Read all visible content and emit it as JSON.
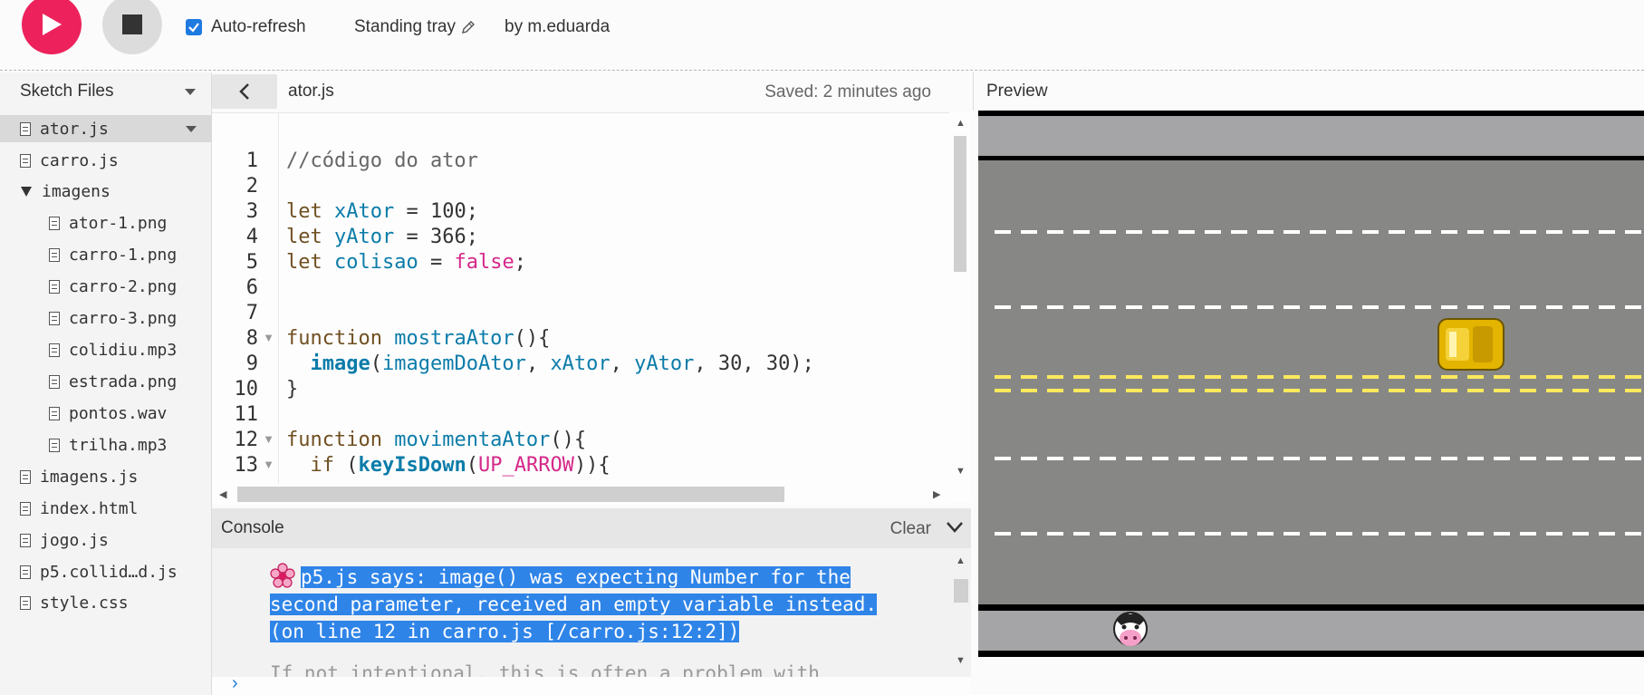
{
  "toolbar": {
    "play_icon": "play-icon",
    "stop_icon": "stop-icon",
    "autorefresh_label": "Auto-refresh",
    "autorefresh_checked": true,
    "sketch_name": "Standing tray",
    "author": "by m.eduarda",
    "accent_color": "#ed225d"
  },
  "sidebar": {
    "title": "Sketch Files",
    "files": [
      {
        "label": "ator.js",
        "selected": true
      },
      {
        "label": "carro.js"
      },
      {
        "label": "imagens",
        "folder": true
      },
      {
        "label": "ator-1.png"
      },
      {
        "label": "carro-1.png"
      },
      {
        "label": "carro-2.png"
      },
      {
        "label": "carro-3.png"
      },
      {
        "label": "colidiu.mp3"
      },
      {
        "label": "estrada.png"
      },
      {
        "label": "pontos.wav"
      },
      {
        "label": "trilha.mp3"
      },
      {
        "label": "imagens.js"
      },
      {
        "label": "index.html"
      },
      {
        "label": "jogo.js"
      },
      {
        "label": "p5.collid…d.js"
      },
      {
        "label": "style.css"
      }
    ]
  },
  "editor": {
    "file_tab": "ator.js",
    "saved_status": "Saved: 2 minutes ago",
    "line_numbers": [
      "1",
      "2",
      "3",
      "4",
      "5",
      "6",
      "7",
      "8",
      "9",
      "10",
      "11",
      "12",
      "13"
    ]
  },
  "console": {
    "title": "Console",
    "clear_label": "Clear",
    "message_line1": "p5.js says: image() was expecting Number for the",
    "message_line2": "second parameter, received an empty variable instead.",
    "message_line3": "(on line 12 in carro.js [/carro.js:12:2])",
    "next_line": "If not intentional, this is often a problem with"
  },
  "preview": {
    "title": "Preview"
  }
}
